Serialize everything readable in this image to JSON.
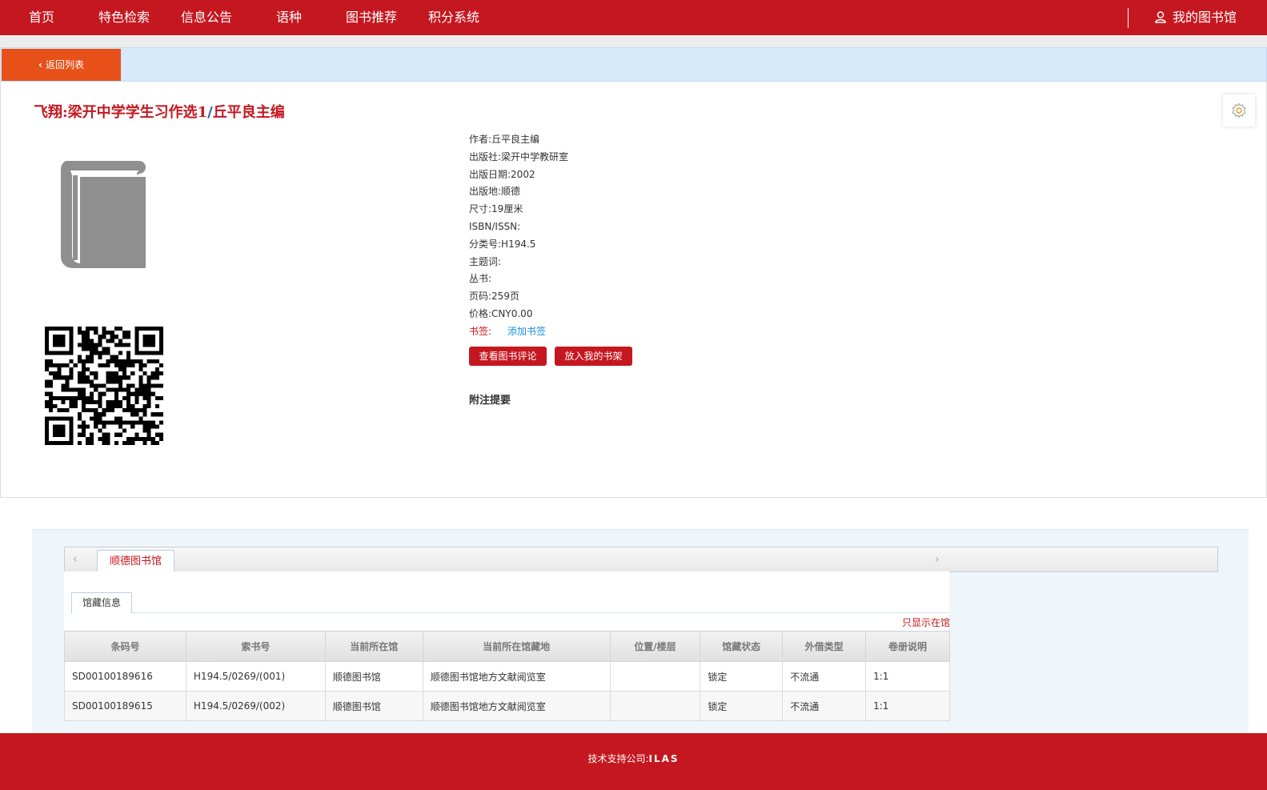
{
  "nav": {
    "items": [
      {
        "label": "首页"
      },
      {
        "label": "特色检索"
      },
      {
        "label": "信息公告"
      },
      {
        "label": "语种"
      },
      {
        "label": "图书推荐"
      },
      {
        "label": "积分系统"
      }
    ],
    "my_library": "我的图书馆"
  },
  "back_label": "返回列表",
  "book": {
    "title_main": "飞翔:梁开中学学生习作选1",
    "title_sep": "/",
    "title_author": "丘平良主编"
  },
  "meta": {
    "author_label": "作者:",
    "author": "丘平良主编",
    "publisher_label": "出版社:",
    "publisher": "梁开中学教研室",
    "pubdate_label": "出版日期:",
    "pubdate": "2002",
    "place_label": "出版地:",
    "place": "顺德",
    "size_label": "尺寸:",
    "size": "19厘米",
    "isbn_label": "ISBN/ISSN:",
    "isbn": "",
    "class_label": "分类号:",
    "class": "H194.5",
    "subject_label": "主题词:",
    "subject": "",
    "series_label": "丛书:",
    "series": "",
    "pages_label": "页码:",
    "pages": "259页",
    "price_label": "价格:",
    "price": "CNY0.00",
    "bookmark_label": "书签:",
    "bookmark_link": "添加书签"
  },
  "buttons": {
    "reviews": "查看图书评论",
    "shelf": "放入我的书架"
  },
  "note_title": "附注提要",
  "holdings": {
    "library_tab": "顺德图书馆",
    "sub_tab": "馆藏信息",
    "only_available": "只显示在馆",
    "columns": [
      "条码号",
      "索书号",
      "当前所在馆",
      "当前所在馆藏地",
      "位置/楼层",
      "馆藏状态",
      "外借类型",
      "卷册说明"
    ],
    "rows": [
      [
        "SD00100189616",
        "H194.5/0269/(001)",
        "顺德图书馆",
        "顺德图书馆地方文献阅览室",
        "",
        "锁定",
        "不流通",
        "1:1"
      ],
      [
        "SD00100189615",
        "H194.5/0269/(002)",
        "顺德图书馆",
        "顺德图书馆地方文献阅览室",
        "",
        "锁定",
        "不流通",
        "1:1"
      ]
    ]
  },
  "footer": {
    "label": "技术支持公司:",
    "company": "ILAS"
  },
  "colors": {
    "brand_red": "#c5171f",
    "back_orange": "#e8501a",
    "link_blue": "#1a8fd6",
    "bar_blue": "#d6eafb"
  }
}
